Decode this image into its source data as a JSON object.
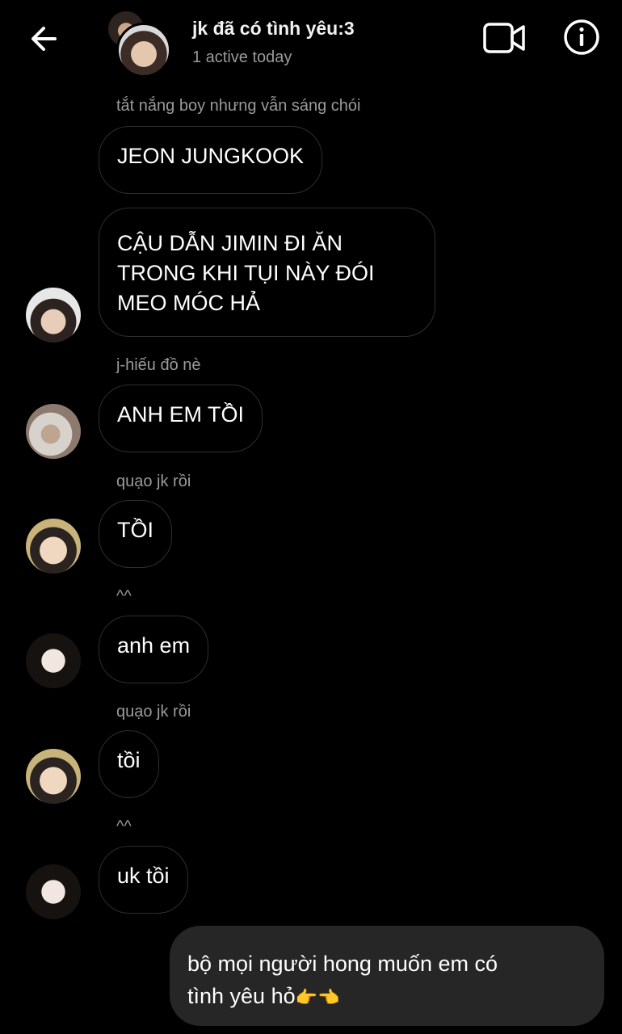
{
  "header": {
    "title": "jk đã có tình yêu:3",
    "status": "1 active today"
  },
  "messages": [
    {
      "sender_label": "tắt nắng boy nhưng vẫn sáng chói",
      "lines": [
        "JEON JUNGKOOK",
        "CẬU DẪN JIMIN ĐI ĂN",
        "TRONG KHI TỤI NÀY ĐÓI",
        "MEO MÓC HẢ"
      ]
    },
    {
      "sender_label": "j-hiếu đồ nè",
      "lines": [
        "ANH EM TỒI"
      ]
    },
    {
      "sender_label": "quạo jk rồi",
      "lines": [
        "TỒI"
      ]
    },
    {
      "sender_label": "^^",
      "lines": [
        "anh em"
      ]
    },
    {
      "sender_label": "quạo jk rồi",
      "lines": [
        "tồi"
      ]
    },
    {
      "sender_label": "^^",
      "lines": [
        "uk tồi"
      ]
    }
  ],
  "outgoing": {
    "line1": "bộ mọi người hong muốn em có",
    "line2": "tình yêu hỏ",
    "emoji": "👉👈"
  },
  "colors": {
    "background": "#000000",
    "incoming_border": "#2e2e2e",
    "outgoing_bg": "#262626",
    "secondary_text": "#9a9a9a"
  },
  "icons": [
    "back-arrow-icon",
    "video-call-icon",
    "info-icon"
  ]
}
